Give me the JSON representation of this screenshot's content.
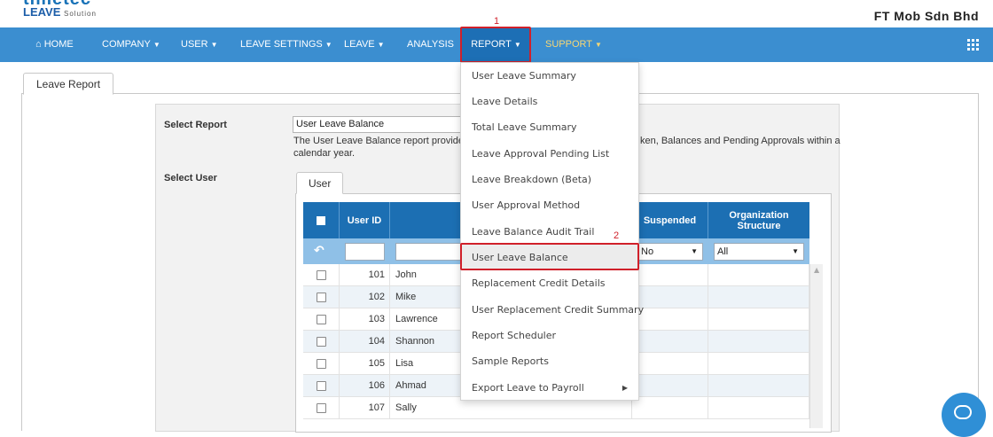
{
  "logo": {
    "top_text": "timetec",
    "brand": "LEAVE",
    "brand_suffix": "Solution"
  },
  "company_name": "FT Mob Sdn Bhd",
  "nav": {
    "home": "HOME",
    "company": "COMPANY",
    "user": "USER",
    "leave_settings": "LEAVE SETTINGS",
    "leave": "LEAVE",
    "analysis": "ANALYSIS",
    "report": "REPORT",
    "support": "SUPPORT"
  },
  "annotations": {
    "step1": "1",
    "step2": "2"
  },
  "page_tab": "Leave Report",
  "form": {
    "select_report_label": "Select Report",
    "select_report_value": "User Leave Balance",
    "description_part1": "The User Leave Balance report provides",
    "description_part2": "ken, Balances and Pending Approvals within a",
    "description_part3": "calendar year.",
    "select_user_label": "Select User",
    "user_tab": "User"
  },
  "grid": {
    "headers": {
      "user_id": "User ID",
      "suspended": "Suspended",
      "org_structure": "Organization Structure"
    },
    "filters": {
      "suspended": "No",
      "org_structure": "All"
    },
    "rows": [
      {
        "id": "101",
        "name": "John"
      },
      {
        "id": "102",
        "name": "Mike"
      },
      {
        "id": "103",
        "name": "Lawrence"
      },
      {
        "id": "104",
        "name": "Shannon"
      },
      {
        "id": "105",
        "name": "Lisa"
      },
      {
        "id": "106",
        "name": "Ahmad"
      },
      {
        "id": "107",
        "name": "Sally"
      }
    ]
  },
  "report_menu": [
    "User Leave Summary",
    "Leave Details",
    "Total Leave Summary",
    "Leave Approval Pending List",
    "Leave Breakdown (Beta)",
    "User Approval Method",
    "Leave Balance Audit Trail",
    "User Leave Balance",
    "Replacement Credit Details",
    "User Replacement Credit Summary",
    "Report Scheduler",
    "Sample Reports",
    "Export Leave to Payroll"
  ],
  "colors": {
    "navbar": "#3b8ed0",
    "nav_active": "#1d6fb5",
    "support": "#f7d774",
    "grid_header": "#1c6fb3",
    "highlight": "#d0202a"
  }
}
